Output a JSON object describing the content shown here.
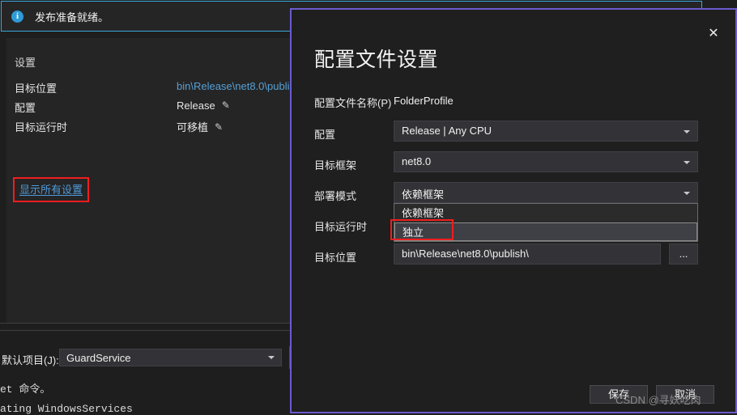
{
  "background": {
    "info_banner": {
      "icon": "info-icon",
      "message": "发布准备就绪。"
    },
    "settings_panel": {
      "heading": "设置",
      "rows": [
        {
          "label": "目标位置",
          "value": "bin\\Release\\net8.0\\publi",
          "is_link": true,
          "editable": false
        },
        {
          "label": "配置",
          "value": "Release",
          "is_link": false,
          "editable": true
        },
        {
          "label": "目标运行时",
          "value": "可移植",
          "is_link": false,
          "editable": true
        }
      ],
      "show_all_link": "显示所有设置",
      "edit_icon": "pencil-icon"
    },
    "bottom_bar": {
      "default_project_label": "默认项目(J):",
      "default_project_value": "GuardService",
      "dropdown_icon": "chevron-down-icon"
    },
    "console": {
      "line1": "et 命令。",
      "line2": "ating WindowsServices"
    }
  },
  "dialog": {
    "title": "配置文件设置",
    "close_icon": "close-icon",
    "profile_name": {
      "label": "配置文件名称(P)",
      "value": "FolderProfile"
    },
    "fields": [
      {
        "label": "配置",
        "value": "Release | Any CPU",
        "type": "combobox"
      },
      {
        "label": "目标框架",
        "value": "net8.0",
        "type": "combobox"
      },
      {
        "label": "部署模式",
        "value": "依赖框架",
        "type": "combobox"
      },
      {
        "label": "目标运行时",
        "value": "",
        "type": "combobox"
      },
      {
        "label": "目标位置",
        "value": "bin\\Release\\net8.0\\publish\\",
        "type": "textbox"
      }
    ],
    "browse_button": "...",
    "deploy_mode_dropdown": {
      "open": true,
      "options": [
        "依赖框架",
        "独立"
      ],
      "selected": "独立"
    },
    "footer": {
      "save_label": "保存",
      "cancel_label": "取消"
    }
  },
  "watermark": "CSDN @寻妖吃肉",
  "colors": {
    "dialog_border": "#6a5acd",
    "banner_border": "#3aa7d8",
    "annotation_red": "#f01e1e",
    "link_blue": "#56a0d3",
    "panel_bg": "#252526",
    "window_bg": "#1e1e1e",
    "control_bg": "#333337"
  }
}
